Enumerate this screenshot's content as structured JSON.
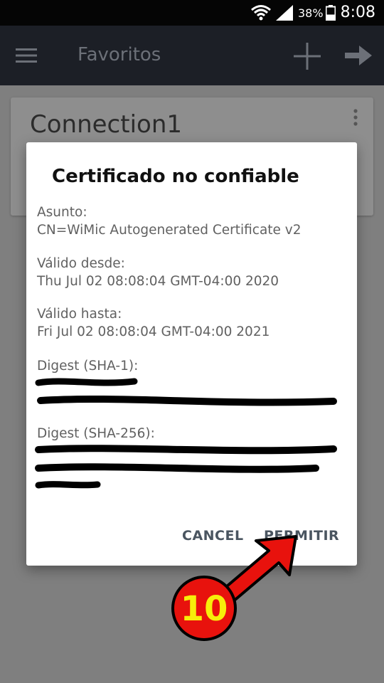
{
  "status_bar": {
    "battery": "38%",
    "time": "8:08"
  },
  "app_bar": {
    "title": "Favoritos"
  },
  "favorites": [
    {
      "name": "Connection1"
    }
  ],
  "dialog": {
    "title": "Certificado no confiable",
    "subject_label": "Asunto:",
    "subject_value": "CN=WiMic Autogenerated Certificate v2",
    "valid_from_label": "Válido desde:",
    "valid_from_value": "Thu Jul 02 08:08:04 GMT-04:00 2020",
    "valid_to_label": "Válido hasta:",
    "valid_to_value": "Fri Jul 02 08:08:04 GMT-04:00 2021",
    "sha1_label": "Digest (SHA-1):",
    "sha256_label": "Digest (SHA-256):",
    "cancel_label": "CANCEL",
    "allow_label": "PERMITIR"
  },
  "annotation": {
    "step_number": "10",
    "arrow_color": "#e8120d",
    "text_color": "#f7ee0a"
  }
}
